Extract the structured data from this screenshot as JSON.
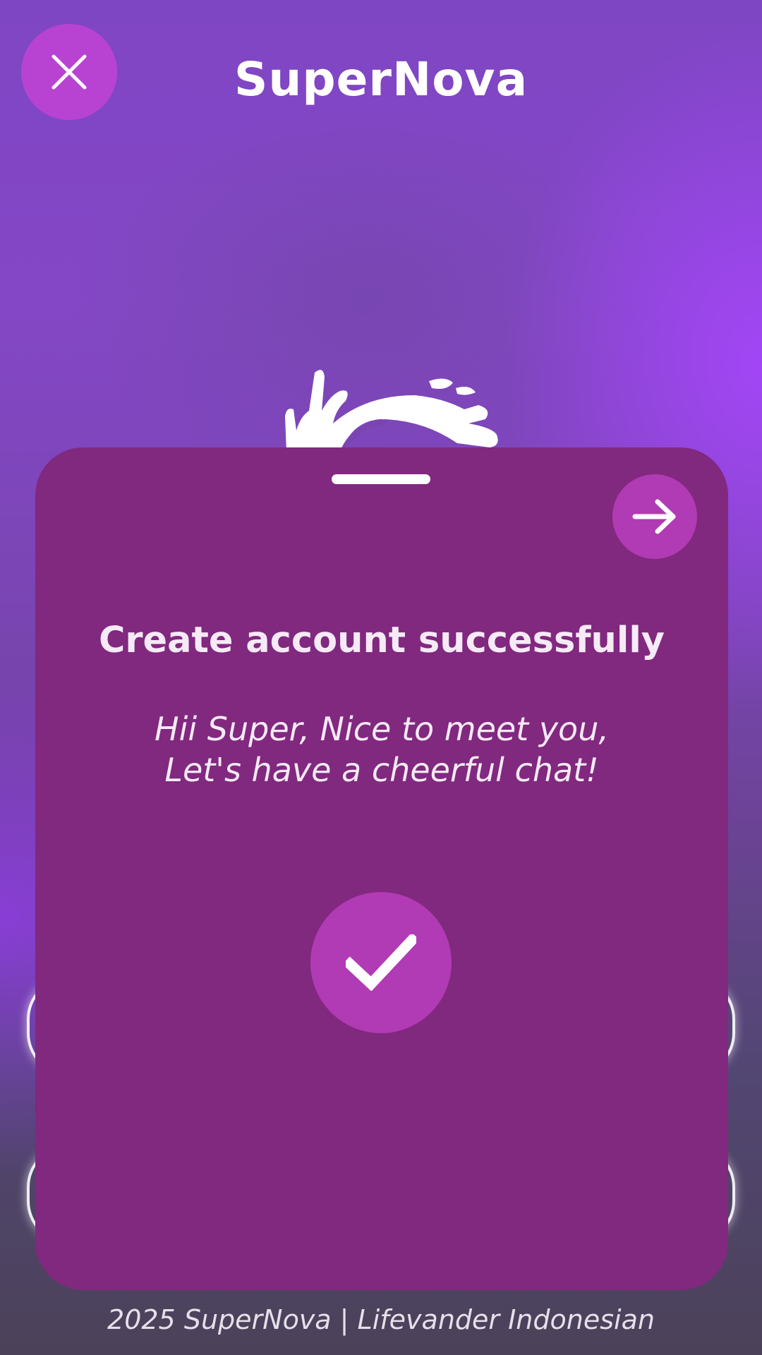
{
  "header": {
    "title": "SuperNova",
    "close_icon": "close-icon"
  },
  "dialog": {
    "title": "Create account successfully",
    "message_line1": "Hii Super, Nice to meet you,",
    "message_line2": "Let's have a cheerful chat!",
    "next_icon": "arrow-right-icon",
    "status_icon": "checkmark-icon"
  },
  "footer": {
    "text": "2025 SuperNova | Lifevander Indonesian"
  },
  "colors": {
    "card": "#81287f",
    "accent": "#b13bb4",
    "close_button": "#b843d3"
  }
}
